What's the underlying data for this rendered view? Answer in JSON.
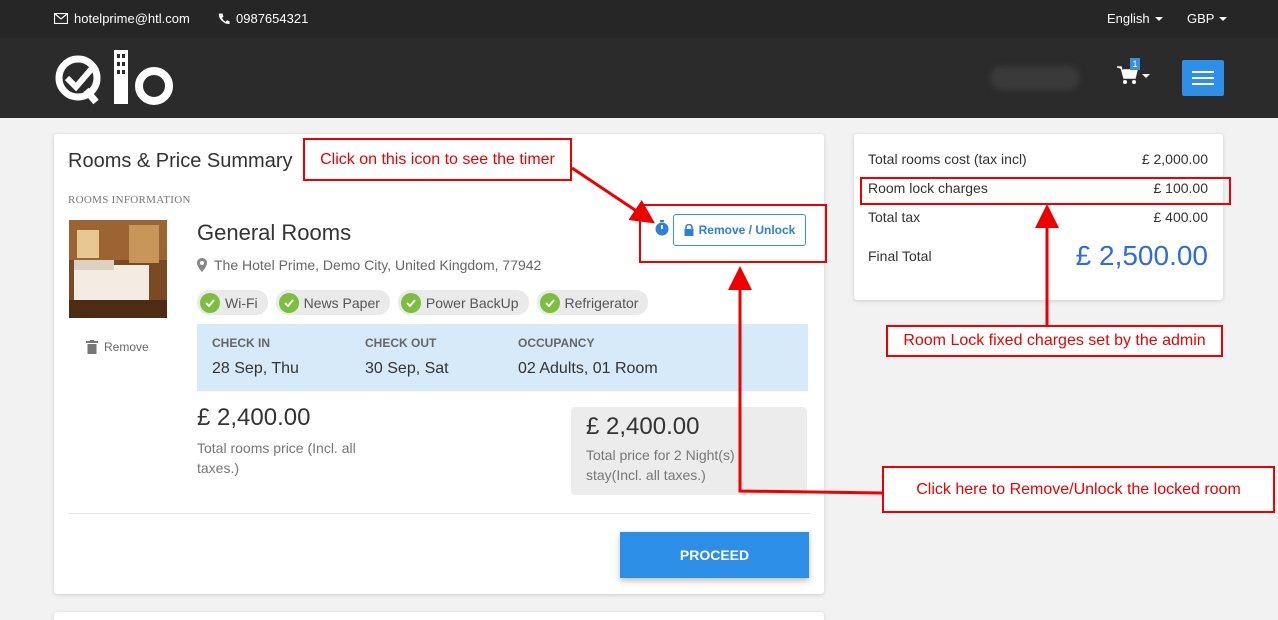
{
  "topbar": {
    "email": "hotelprime@htl.com",
    "phone": "0987654321",
    "language": "English",
    "currency": "GBP"
  },
  "header": {
    "cart_count": "1"
  },
  "room_card": {
    "title": "Rooms & Price Summary",
    "section_label": "ROOMS INFORMATION",
    "room_name": "General Rooms",
    "address": "The Hotel Prime, Demo City, United Kingdom, 77942",
    "amenities": [
      "Wi-Fi",
      "News Paper",
      "Power BackUp",
      "Refrigerator"
    ],
    "remove_label": "Remove",
    "unlock_label": "Remove / Unlock",
    "check_in_label": "CHECK IN",
    "check_in_value": "28 Sep, Thu",
    "check_out_label": "CHECK OUT",
    "check_out_value": "30 Sep, Sat",
    "occupancy_label": "OCCUPANCY",
    "occupancy_value": "02 Adults, 01 Room",
    "room_price": "£ 2,400.00",
    "room_price_note": "Total rooms price (Incl. all taxes.)",
    "total_price": "£ 2,400.00",
    "total_price_note": "Total price for 2 Night(s) stay(Incl. all taxes.)",
    "proceed_label": "PROCEED"
  },
  "summary": {
    "rooms_cost_label": "Total rooms cost (tax incl)",
    "rooms_cost_value": "£ 2,000.00",
    "lock_label": "Room lock charges",
    "lock_value": "£ 100.00",
    "tax_label": "Total tax",
    "tax_value": "£ 400.00",
    "final_label": "Final Total",
    "final_value": "£ 2,500.00"
  },
  "annotations": {
    "timer": "Click on this icon to see the timer",
    "lock_charges": "Room Lock fixed charges set by the admin",
    "unlock": "Click here to Remove/Unlock the locked room"
  },
  "colors": {
    "accent": "#2d8ee8",
    "annotation": "#ee0000",
    "stay_box": "#d6eaf9",
    "amenity_check": "#7cbf3f"
  }
}
